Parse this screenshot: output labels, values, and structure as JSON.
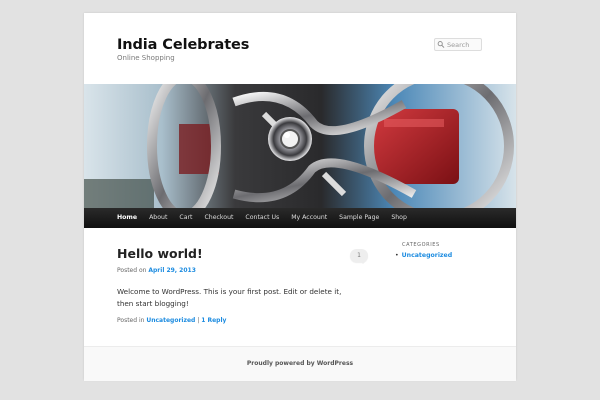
{
  "site": {
    "title": "India Celebrates",
    "description": "Online Shopping"
  },
  "search": {
    "placeholder": "Search",
    "icon": "search-icon"
  },
  "header_image": {
    "subject": "chrome steering wheel close-up",
    "colors": {
      "chrome": "#c9c9cc",
      "red": "#b51f26",
      "blue": "#4aa0d6",
      "dark": "#1c1c1e"
    }
  },
  "nav": {
    "items": [
      {
        "label": "Home"
      },
      {
        "label": "About"
      },
      {
        "label": "Cart"
      },
      {
        "label": "Checkout"
      },
      {
        "label": "Contact Us"
      },
      {
        "label": "My Account"
      },
      {
        "label": "Sample Page"
      },
      {
        "label": "Shop"
      }
    ]
  },
  "post": {
    "title": "Hello world!",
    "meta_prefix": "Posted on",
    "date": "April 29, 2013",
    "comment_count": "1",
    "content": "Welcome to WordPress. This is your first post. Edit or delete it, then start blogging!",
    "footer_prefix": "Posted in",
    "category": "Uncategorized",
    "separator": "|",
    "reply": "1 Reply"
  },
  "sidebar": {
    "widget_title": "Categories",
    "items": [
      {
        "label": "Uncategorized"
      }
    ]
  },
  "footer": {
    "text": "Proudly powered by WordPress"
  },
  "colors": {
    "link": "#1b8be0",
    "nav_bg": "#1a1a1a",
    "page_bg": "#e2e2e2"
  }
}
